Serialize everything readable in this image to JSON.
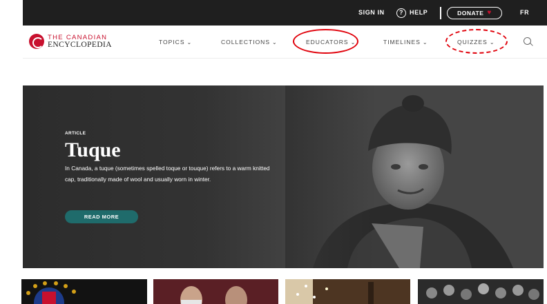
{
  "topbar": {
    "sign_in": "SIGN IN",
    "help_icon": "?",
    "help": "HELP",
    "donate": "DONATE",
    "donate_icon": "♥",
    "language": "FR"
  },
  "logo": {
    "line1": "THE CANADIAN",
    "line2": "ENCYCLOPEDIA"
  },
  "nav": {
    "items": [
      {
        "label": "TOPICS"
      },
      {
        "label": "COLLECTIONS"
      },
      {
        "label": "EDUCATORS"
      },
      {
        "label": "TIMELINES"
      },
      {
        "label": "QUIZZES"
      }
    ],
    "chevron": "⌄",
    "search_icon": "search-icon"
  },
  "annotations": {
    "solid_circle_color": "#e0000a",
    "dashed_circle_color": "#e0000a"
  },
  "hero": {
    "eyebrow": "ARTICLE",
    "title": "Tuque",
    "summary": "In Canada, a tuque (sometimes spelled toque or touque) refers to a warm knitted cap, traditionally made of wool and usually worn in winter.",
    "button": "READ MORE",
    "button_color": "#1f6b6b"
  },
  "brand": {
    "red": "#c8102e",
    "topbar_bg": "#1f1f1f"
  }
}
